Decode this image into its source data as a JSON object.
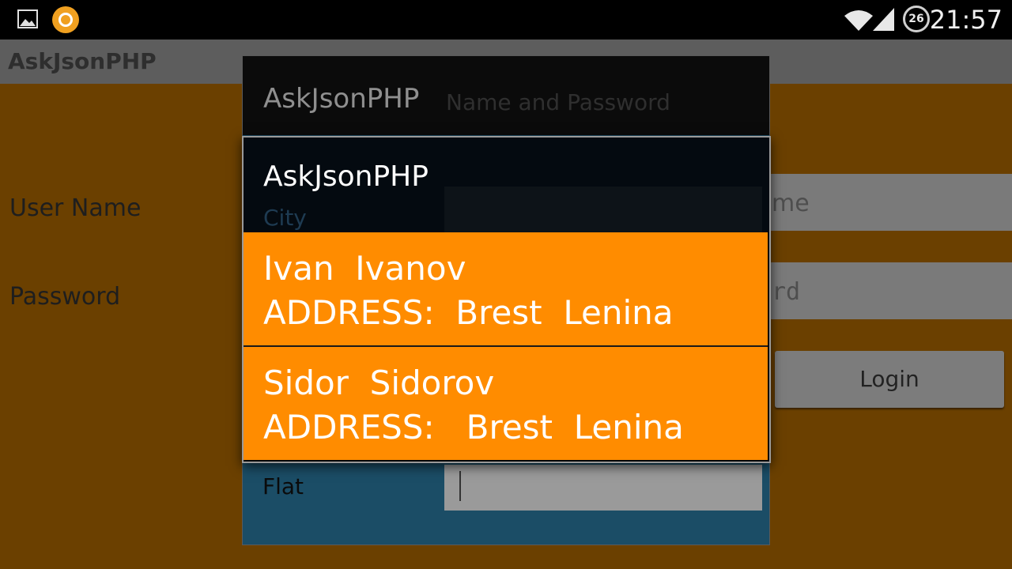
{
  "status_bar": {
    "time": "21:57",
    "battery_level": "26",
    "icons": [
      "gallery-icon",
      "avast-icon",
      "wifi-icon",
      "signal-icon"
    ]
  },
  "app": {
    "title": "AskJsonPHP"
  },
  "form": {
    "username_label": "User Name",
    "username_hint_visible": "me",
    "password_label": "Password",
    "password_hint_visible": "rd",
    "login_button": "Login"
  },
  "background_dialog": {
    "title": "AskJsonPHP",
    "subtitle": "Name and Password",
    "city_label": "City",
    "flat_label": "Flat"
  },
  "list_dialog": {
    "title": "AskJsonPHP",
    "items": [
      {
        "name": "Ivan  Ivanov",
        "address": "ADDRESS:  Brest  Lenina"
      },
      {
        "name": "Sidor  Sidorov",
        "address": "ADDRESS:   Brest  Lenina"
      }
    ]
  },
  "colors": {
    "main_background": "#6b4000",
    "list_item": "#ff8c00",
    "dialog_body": "#1b4d66"
  }
}
